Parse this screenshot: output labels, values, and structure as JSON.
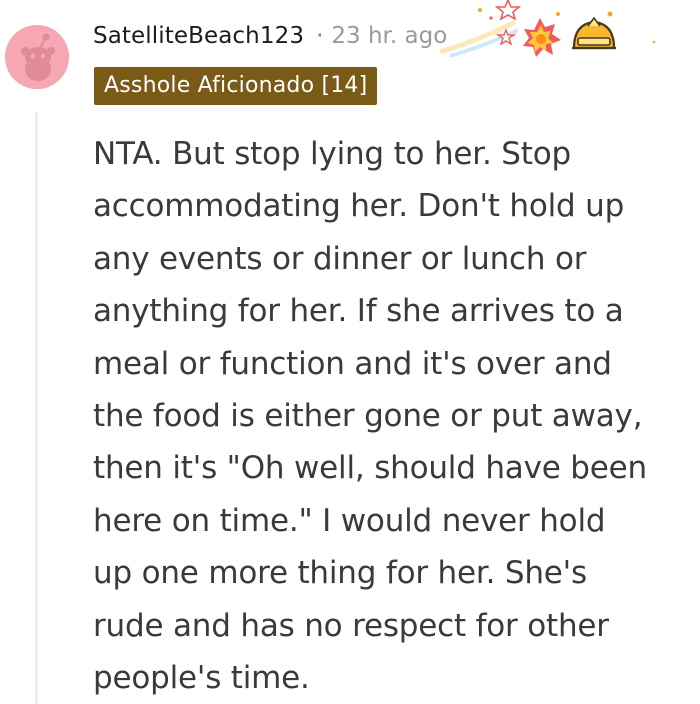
{
  "comment": {
    "author": "SatelliteBeach123",
    "separator": "·",
    "timestamp": "23 hr. ago",
    "flair": "Asshole Aficionado [14]",
    "body": "NTA. But stop lying to her. Stop\naccommodating her. Don't hold up\nany events or dinner or lunch or\nanything for her. If she arrives to a\nmeal or function and it's over and\nthe food is either gone or put away,\nthen it's \"Oh well, should have been\nhere on time.\" I would never hold\nup one more thing for her. She's\nrude and has no respect for other\npeople's time."
  },
  "colors": {
    "avatar_bg": "#f6a7b3",
    "flair_bg": "#7a5a17",
    "flair_text": "#ffffff",
    "timestamp": "#9a9a9a",
    "body_text": "#3a3a3a"
  },
  "icons": {
    "avatar": "snoo-avatar-icon",
    "award_1": "shooting-star-award-icon",
    "award_2": "burst-award-icon",
    "award_3": "golden-helmet-award-icon"
  }
}
